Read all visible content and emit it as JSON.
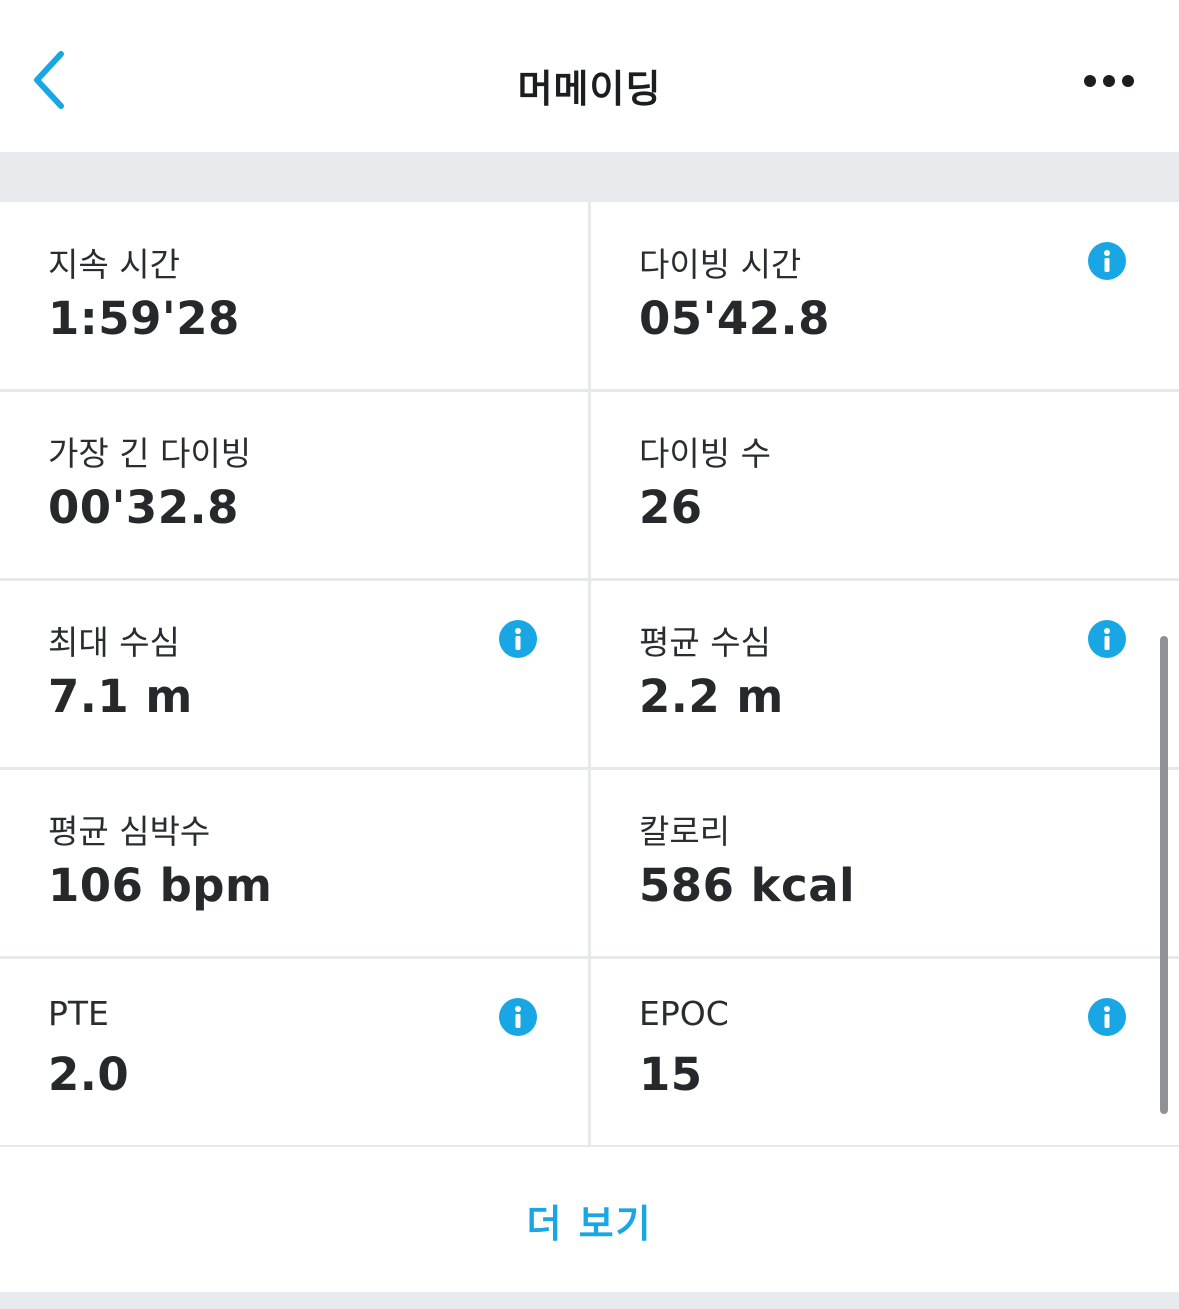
{
  "header": {
    "title": "머메이딩",
    "back_icon": "chevron-left-icon",
    "more_icon": "more-horizontal-icon"
  },
  "stats": [
    {
      "label": "지속 시간",
      "value": "1:59'28",
      "info": false
    },
    {
      "label": "다이빙 시간",
      "value": "05'42.8",
      "info": true
    },
    {
      "label": "가장 긴 다이빙",
      "value": "00'32.8",
      "info": false
    },
    {
      "label": "다이빙 수",
      "value": "26",
      "info": false
    },
    {
      "label": "최대 수심",
      "value": "7.1 m",
      "info": true
    },
    {
      "label": "평균 수심",
      "value": "2.2 m",
      "info": true
    },
    {
      "label": "평균 심박수",
      "value": "106 bpm",
      "info": false
    },
    {
      "label": "칼로리",
      "value": "586 kcal",
      "info": false
    },
    {
      "label": "PTE",
      "value": "2.0",
      "info": true
    },
    {
      "label": "EPOC",
      "value": "15",
      "info": true
    }
  ],
  "more_label": "더 보기",
  "colors": {
    "accent": "#18a7e4",
    "separator": "#e6e8ea",
    "band": "#e8ebee",
    "text": "#26282c"
  }
}
